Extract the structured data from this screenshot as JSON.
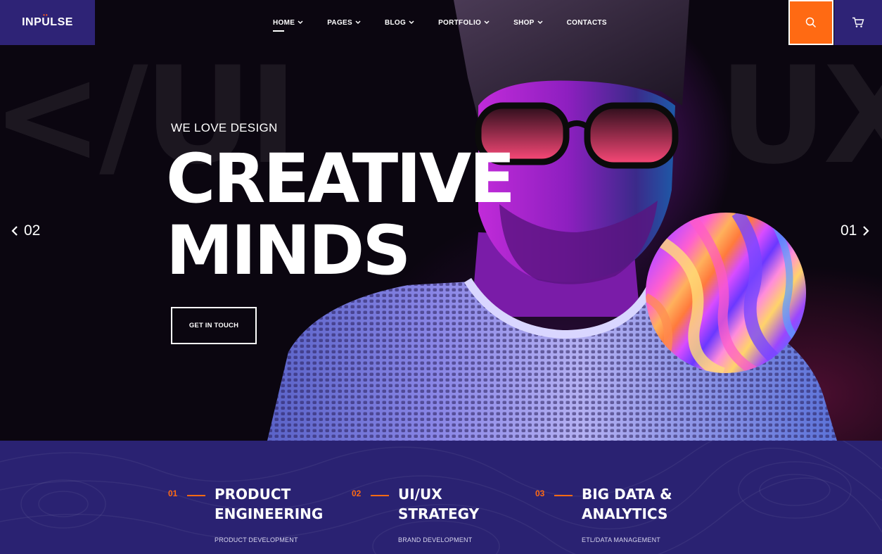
{
  "brand": {
    "name": "INPULSE",
    "dots": "••"
  },
  "nav": {
    "items": [
      {
        "label": "HOME",
        "has_dropdown": true,
        "active": true
      },
      {
        "label": "PAGES",
        "has_dropdown": true,
        "active": false
      },
      {
        "label": "BLOG",
        "has_dropdown": true,
        "active": false
      },
      {
        "label": "PORTFOLIO",
        "has_dropdown": true,
        "active": false
      },
      {
        "label": "SHOP",
        "has_dropdown": true,
        "active": false
      },
      {
        "label": "CONTACTS",
        "has_dropdown": false,
        "active": false
      }
    ],
    "chevron": "⌄"
  },
  "header_icons": {
    "search": "search-icon",
    "cart": "cart-icon"
  },
  "hero": {
    "bg_word_left": "</UI",
    "bg_word_right": "UX>",
    "eyebrow": "WE LOVE DESIGN",
    "title_line1": "CREATIVE",
    "title_line2": "MINDS",
    "cta_label": "GET IN TOUCH",
    "prev_number": "02",
    "next_number": "01"
  },
  "services": [
    {
      "number": "01",
      "title_line1": "PRODUCT",
      "title_line2": "ENGINEERING",
      "subtitle": "PRODUCT DEVELOPMENT"
    },
    {
      "number": "02",
      "title_line1": "UI/UX",
      "title_line2": "STRATEGY",
      "subtitle": "BRAND DEVELOPMENT"
    },
    {
      "number": "03",
      "title_line1": "BIG DATA &",
      "title_line2": "ANALYTICS",
      "subtitle": "ETL/DATA MANAGEMENT"
    }
  ],
  "colors": {
    "accent": "#ff6a13",
    "brand": "#2e2376",
    "services_bg": "#2a2272",
    "hero_bg": "#0b0610"
  }
}
